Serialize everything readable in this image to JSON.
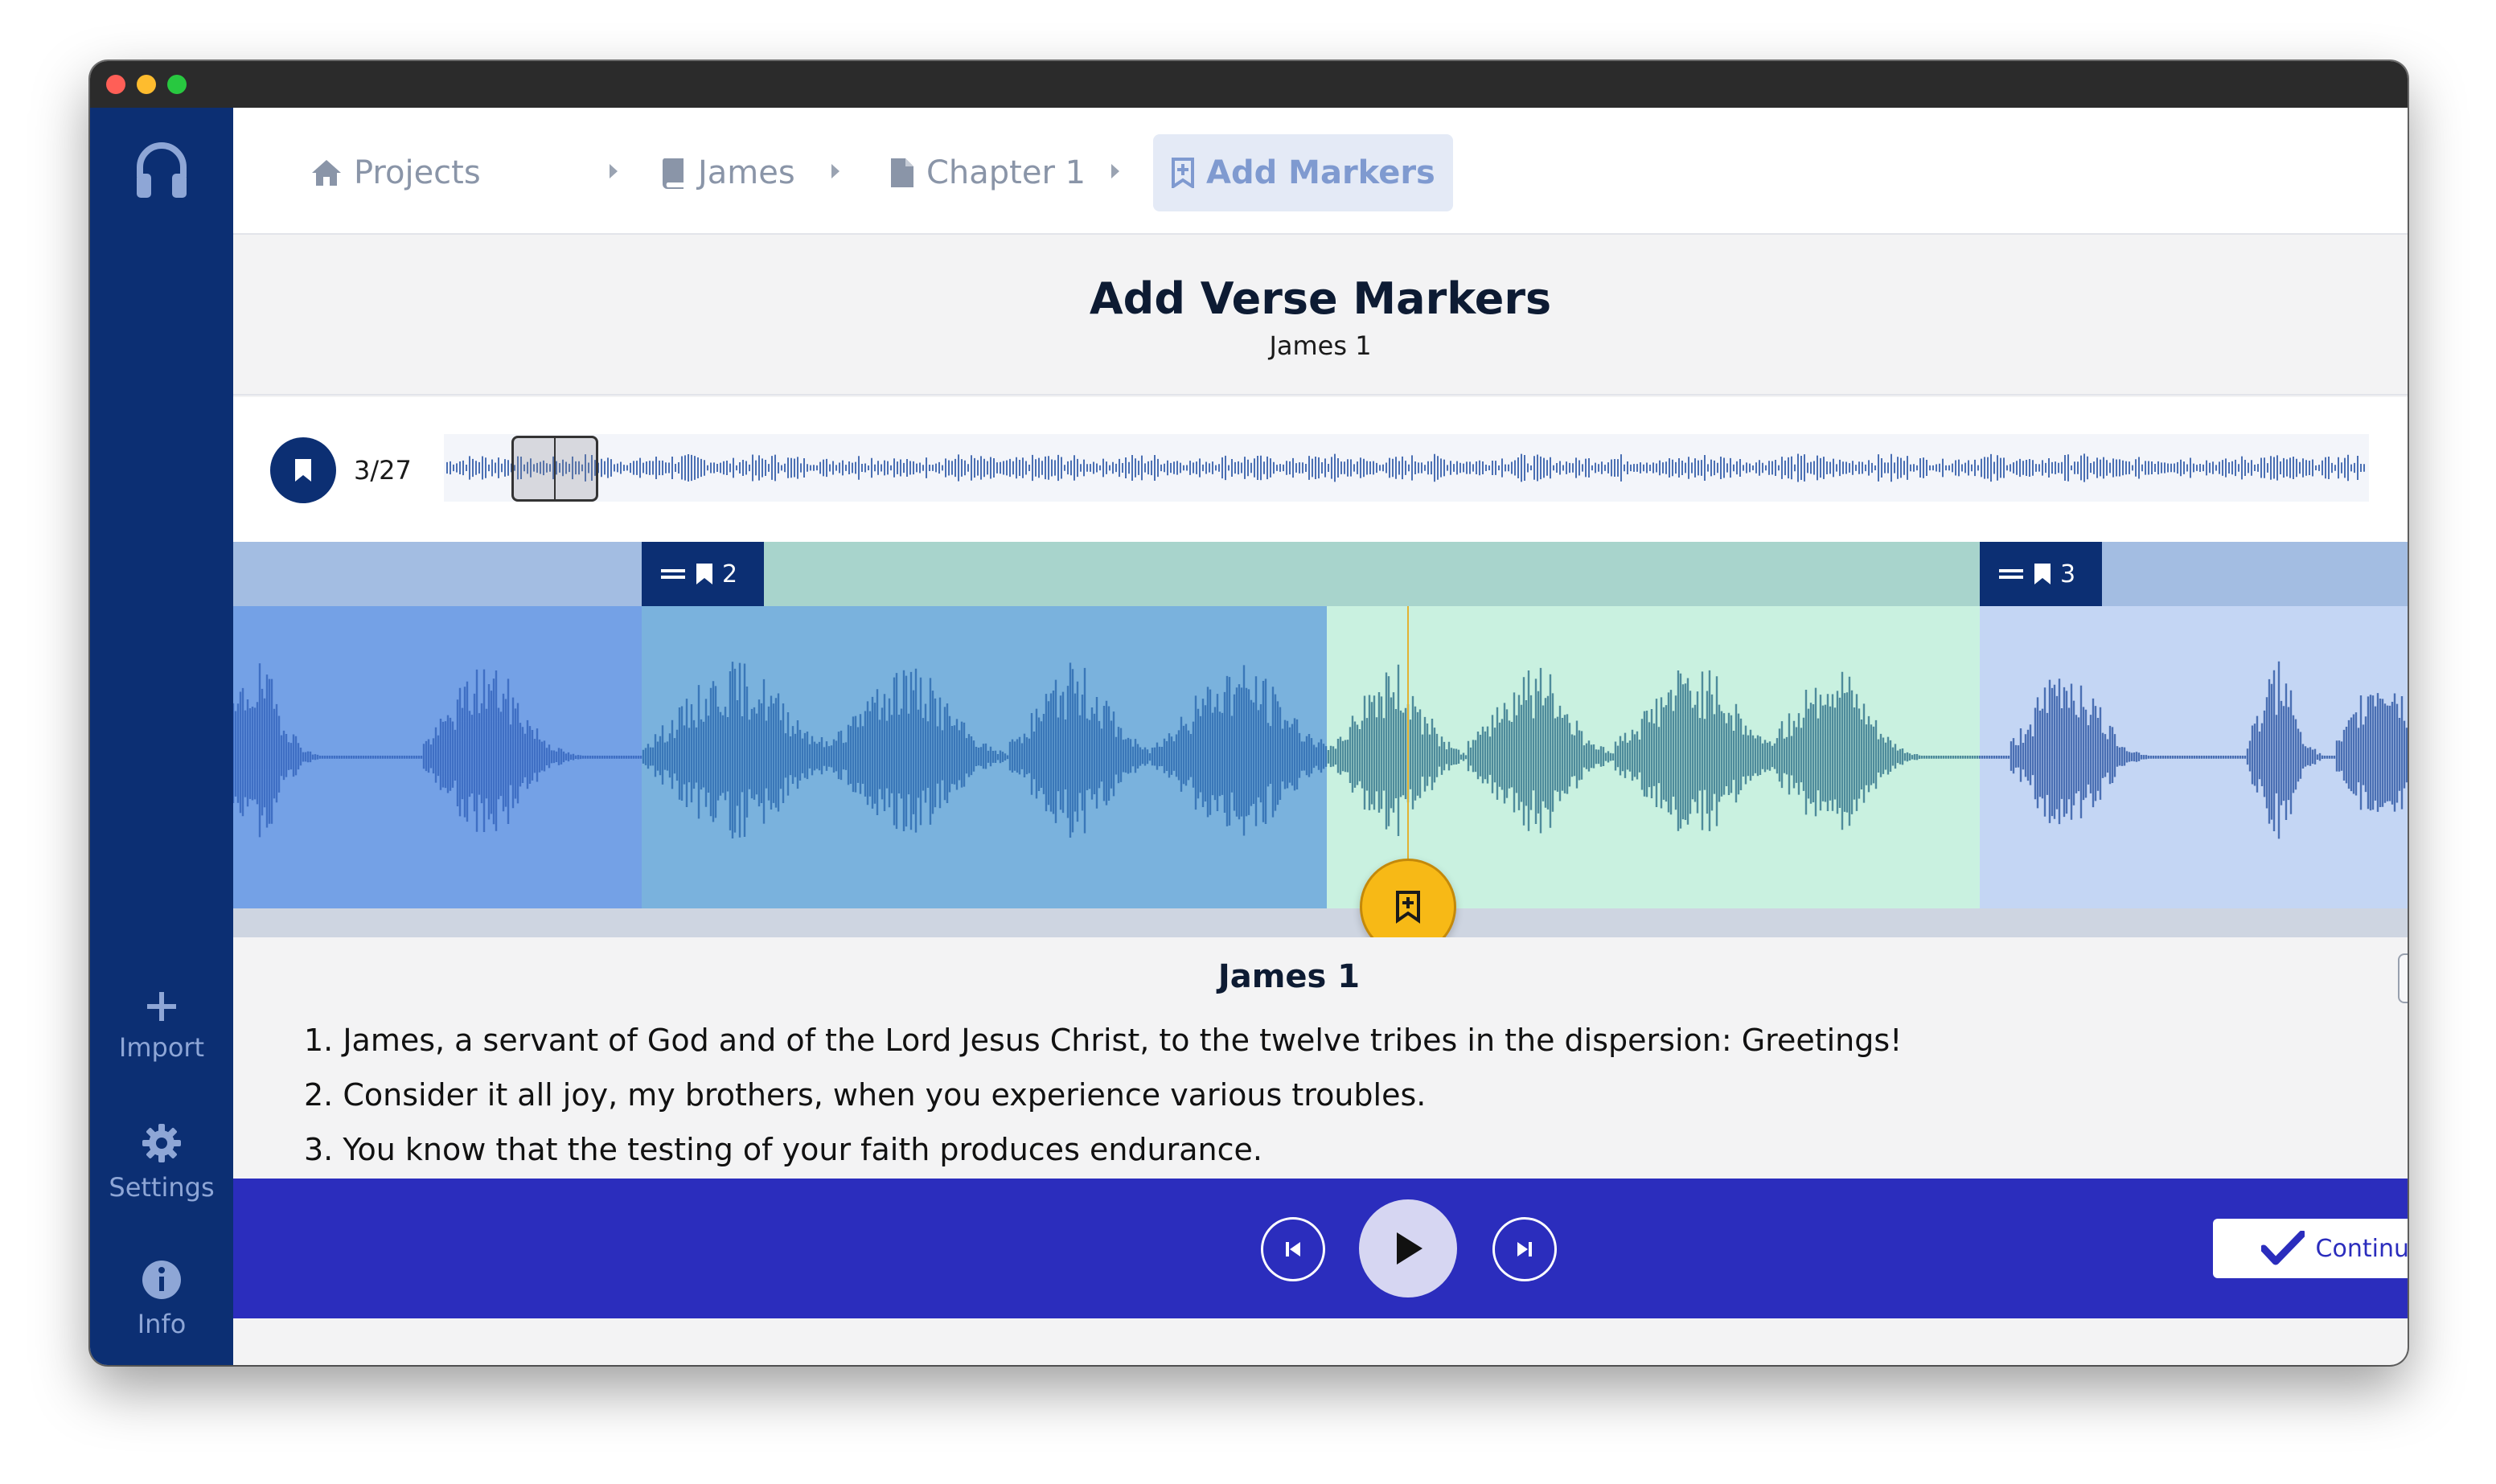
{
  "breadcrumbs": [
    {
      "label": "Projects",
      "icon": "home-icon"
    },
    {
      "label": "James",
      "icon": "book-icon"
    },
    {
      "label": "Chapter 1",
      "icon": "file-icon"
    },
    {
      "label": "Add Markers",
      "icon": "bookmark-add-icon",
      "active": true
    }
  ],
  "sidebar": {
    "items": [
      {
        "label": "Import",
        "icon": "plus-icon"
      },
      {
        "label": "Settings",
        "icon": "gear-icon"
      },
      {
        "label": "Info",
        "icon": "info-icon"
      }
    ]
  },
  "header": {
    "title": "Add Verse Markers",
    "subtitle": "James 1"
  },
  "overview": {
    "marker_count": "3/27",
    "viewport_position": 0.05
  },
  "timeline": {
    "markers": [
      {
        "label": "2",
        "icon": "bookmark-icon"
      },
      {
        "label": "3",
        "icon": "bookmark-icon"
      }
    ],
    "colors": {
      "region_a": "#74a1e6",
      "region_b": "#7ab2dd",
      "region_c": "#c9f1e0",
      "region_d": "#c4d6f4",
      "marker": "#0c2f73",
      "playhead": "#f7b916"
    }
  },
  "text_panel": {
    "title": "James 1",
    "verses": [
      "1. James, a servant of God and of the Lord Jesus Christ, to the twelve tribes in the dispersion: Greetings!",
      "2. Consider it all joy, my brothers, when you experience various troubles.",
      "3. You know that the testing of your faith produces endurance."
    ]
  },
  "player": {
    "continue_label": "Continue"
  },
  "colors": {
    "sidebar": "#0c2f73",
    "player_bar": "#2b2dbd",
    "accent": "#f7b916"
  }
}
